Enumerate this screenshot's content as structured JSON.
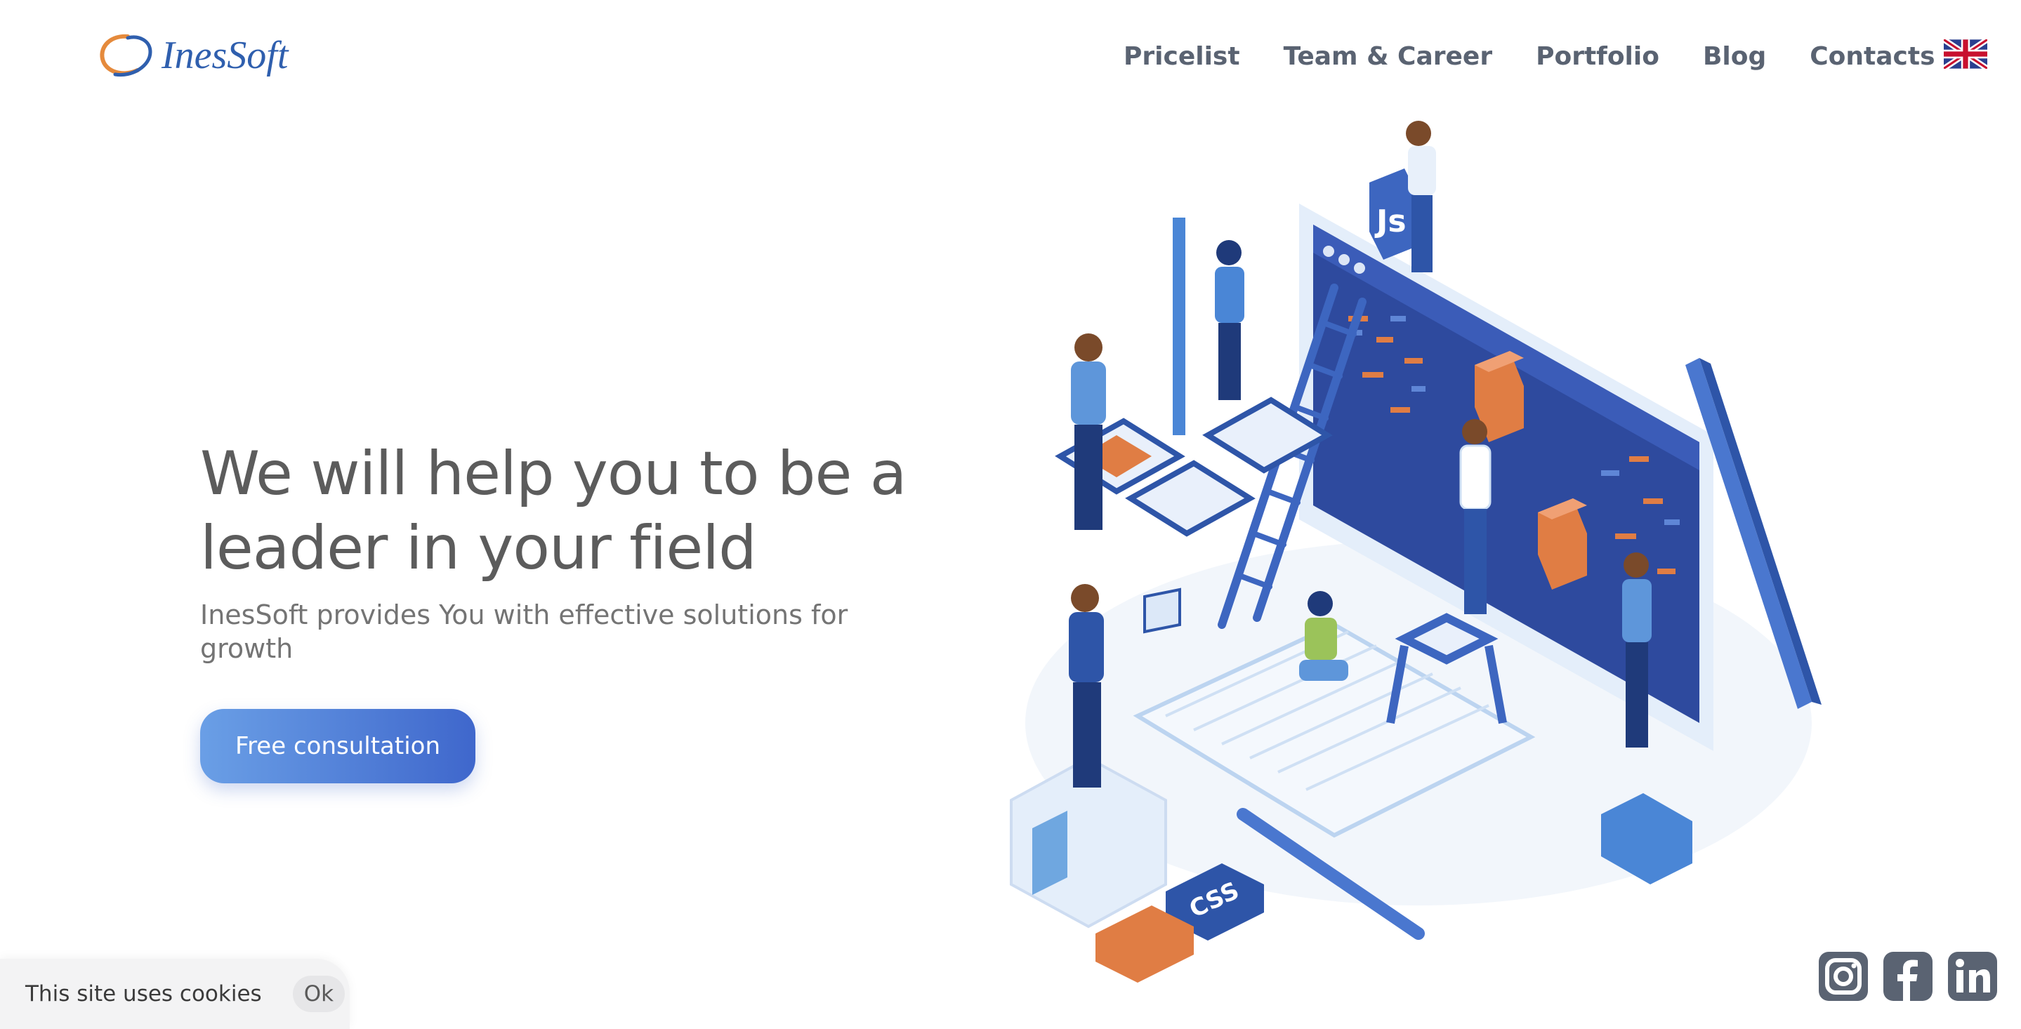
{
  "brand": {
    "logo_text": "InesSoft",
    "logo_icon": "inessoft-swirl-icon",
    "colors": {
      "logo_blue": "#2f5fae",
      "logo_orange": "#e58a3c"
    }
  },
  "nav": {
    "items": [
      {
        "label": "Pricelist"
      },
      {
        "label": "Team & Career"
      },
      {
        "label": "Portfolio"
      },
      {
        "label": "Blog"
      },
      {
        "label": "Contacts"
      }
    ],
    "language_icon": "uk-flag-icon"
  },
  "hero": {
    "title": "We will help you to be a leader in your field",
    "subtitle": "InesSoft provides You with effective solutions for growth",
    "cta_label": "Free consultation",
    "colors": {
      "cta_start": "#6a9fe6",
      "cta_end": "#3f67cc"
    },
    "illustration_labels": {
      "js_cube": "Js",
      "css_block": "CSS"
    }
  },
  "social": {
    "icons": [
      "instagram-icon",
      "facebook-icon",
      "linkedin-icon"
    ],
    "color": "#5a6372"
  },
  "cookie": {
    "text": "This site uses cookies",
    "ok_label": "Ok"
  }
}
